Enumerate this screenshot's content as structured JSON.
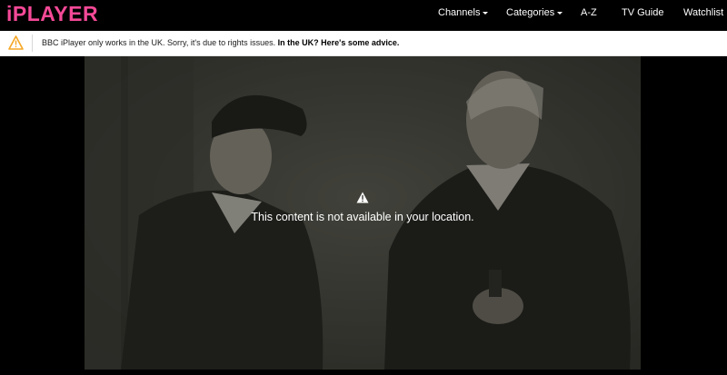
{
  "header": {
    "logo": "iPLAYER",
    "nav": [
      {
        "label": "Channels",
        "has_dropdown": true
      },
      {
        "label": "Categories",
        "has_dropdown": true
      },
      {
        "label": "A-Z",
        "has_dropdown": false
      },
      {
        "label": "TV Guide",
        "has_dropdown": false
      },
      {
        "label": "Watchlist",
        "has_dropdown": false
      }
    ]
  },
  "warning_bar": {
    "icon": "warning-icon",
    "message": "BBC iPlayer only works in the UK. Sorry, it's due to rights issues.",
    "link": "In the UK? Here's some advice."
  },
  "player": {
    "icon": "warning-icon",
    "message": "This content is not available in your location."
  },
  "colors": {
    "brand": "#f54997",
    "warning": "#f5a623"
  }
}
